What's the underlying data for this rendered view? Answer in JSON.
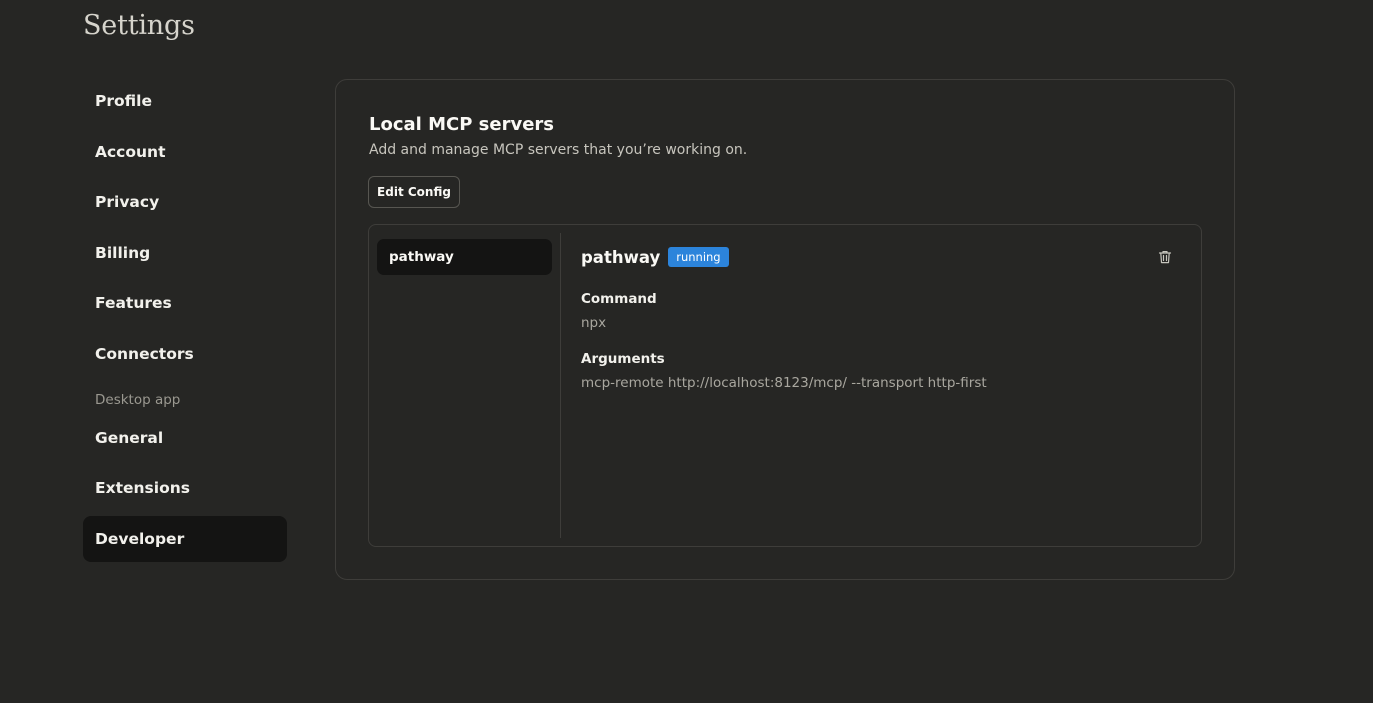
{
  "page": {
    "title": "Settings"
  },
  "sidebar": {
    "items": [
      {
        "label": "Profile"
      },
      {
        "label": "Account"
      },
      {
        "label": "Privacy"
      },
      {
        "label": "Billing"
      },
      {
        "label": "Features"
      },
      {
        "label": "Connectors"
      }
    ],
    "section_label": "Desktop app",
    "app_items": [
      {
        "label": "General"
      },
      {
        "label": "Extensions"
      },
      {
        "label": "Developer",
        "active": true
      }
    ]
  },
  "main": {
    "title": "Local MCP servers",
    "description": "Add and manage MCP servers that you’re working on.",
    "edit_config_label": "Edit Config",
    "servers": [
      {
        "name": "pathway"
      }
    ],
    "selected": {
      "name": "pathway",
      "status": "running",
      "status_color": "#2c84db",
      "command_label": "Command",
      "command_value": "npx",
      "arguments_label": "Arguments",
      "arguments_value": "mcp-remote http://localhost:8123/mcp/ --transport http-first",
      "delete_icon": "trash-icon"
    }
  }
}
